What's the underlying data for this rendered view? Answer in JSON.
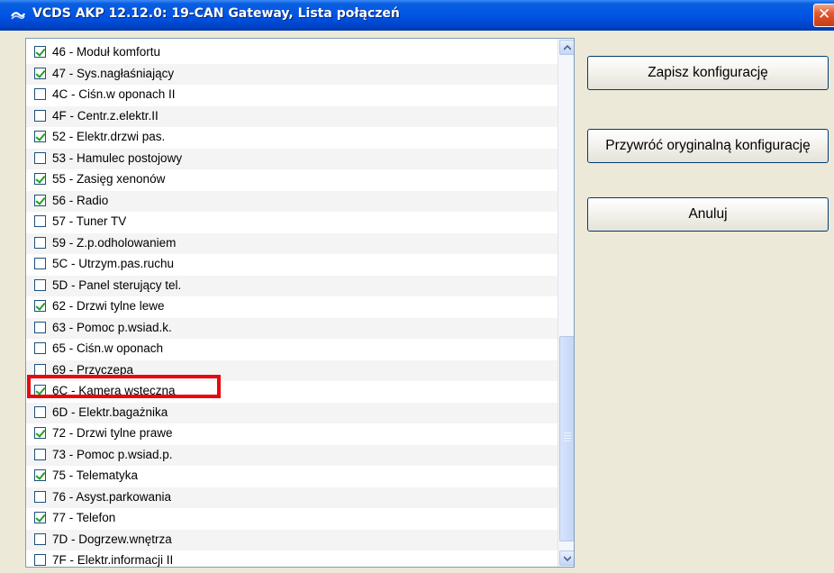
{
  "window": {
    "title": "VCDS AKP 12.12.0: 19-CAN Gateway,  Lista połączeń",
    "close_glyph": "✕"
  },
  "list": {
    "items": [
      {
        "label": "46 - Moduł komfortu",
        "checked": true
      },
      {
        "label": "47 - Sys.nagłaśniający",
        "checked": true
      },
      {
        "label": "4C - Ciśn.w oponach II",
        "checked": false
      },
      {
        "label": "4F - Centr.z.elektr.II",
        "checked": false
      },
      {
        "label": "52 - Elektr.drzwi pas.",
        "checked": true
      },
      {
        "label": "53 - Hamulec postojowy",
        "checked": false
      },
      {
        "label": "55 - Zasięg xenonów",
        "checked": true
      },
      {
        "label": "56 - Radio",
        "checked": true
      },
      {
        "label": "57 - Tuner TV",
        "checked": false
      },
      {
        "label": "59 - Z.p.odholowaniem",
        "checked": false
      },
      {
        "label": "5C - Utrzym.pas.ruchu",
        "checked": false
      },
      {
        "label": "5D - Panel sterujący tel.",
        "checked": false
      },
      {
        "label": "62 - Drzwi tylne lewe",
        "checked": true
      },
      {
        "label": "63 - Pomoc p.wsiad.k.",
        "checked": false
      },
      {
        "label": "65 - Ciśn.w oponach",
        "checked": false
      },
      {
        "label": "69 - Przyczepa",
        "checked": false
      },
      {
        "label": "6C - Kamera wsteczna",
        "checked": true
      },
      {
        "label": "6D - Elektr.bagażnika",
        "checked": false
      },
      {
        "label": "72 - Drzwi tylne prawe",
        "checked": true
      },
      {
        "label": "73 - Pomoc p.wsiad.p.",
        "checked": false
      },
      {
        "label": "75 - Telematyka",
        "checked": true
      },
      {
        "label": "76 - Asyst.parkowania",
        "checked": false
      },
      {
        "label": "77 - Telefon",
        "checked": true
      },
      {
        "label": "7D - Dogrzew.wnętrza",
        "checked": false
      },
      {
        "label": "7F - Elektr.informacji II",
        "checked": false
      }
    ],
    "highlighted_item": "6C - Kamera wsteczna"
  },
  "buttons": {
    "save": "Zapisz konfigurację",
    "restore": "Przywróć oryginalną konfigurację",
    "cancel": "Anuluj"
  },
  "colors": {
    "titlebar": "#0055e5",
    "highlight_border": "#e8080b",
    "check_mark": "#21a121"
  }
}
